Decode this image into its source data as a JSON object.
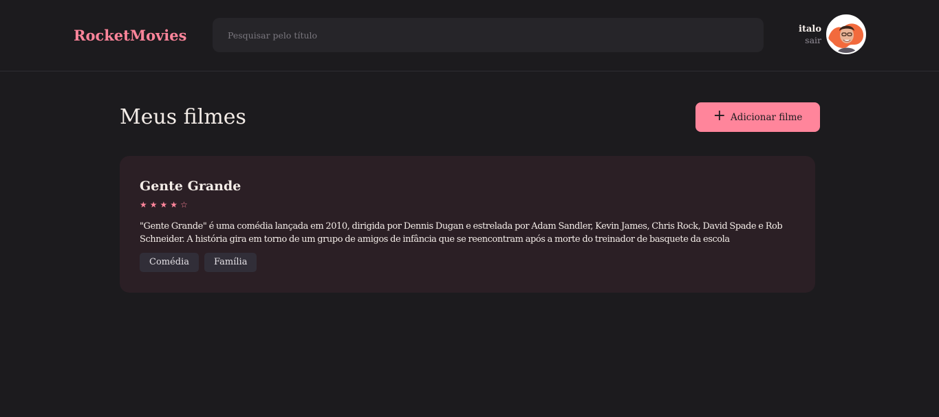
{
  "header": {
    "brand": "RocketMovies",
    "search_placeholder": "Pesquisar pelo título",
    "search_value": "",
    "profile": {
      "name": "italo",
      "logout_label": "sair",
      "avatar_icon": "user-avatar-photo"
    }
  },
  "main": {
    "title": "Meus filmes",
    "add_button": {
      "icon": "plus-icon",
      "plus_glyph": "+",
      "label": "Adicionar filme"
    },
    "movies": [
      {
        "title": "Gente Grande",
        "rating": 4,
        "max_rating": 5,
        "star_full": "★",
        "star_empty": "☆",
        "description": "\"Gente Grande\" é uma comédia lançada em 2010, dirigida por Dennis Dugan e estrelada por Adam Sandler, Kevin James, Chris Rock, David Spade e Rob Schneider. A história gira em torno de um grupo de amigos de infância que se reencontram após a morte do treinador de basquete da escola",
        "tags": [
          "Comédia",
          "Família"
        ]
      }
    ]
  },
  "colors": {
    "background": "#1c1b1e",
    "accent": "#ff859b",
    "card_background": "#2b1f25",
    "input_background": "#262529",
    "tag_background": "#312e38"
  }
}
